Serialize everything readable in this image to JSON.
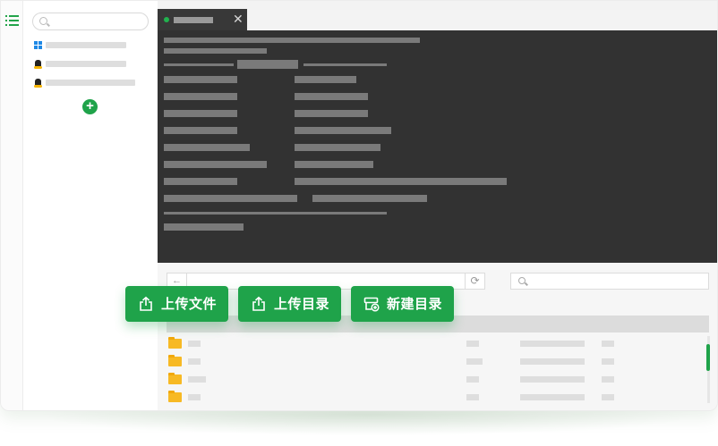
{
  "colors": {
    "accent": "#1fa34a",
    "terminal_bg": "#323232",
    "folder": "#f7b924"
  },
  "rail": {
    "menu_icon": "list-menu-icon"
  },
  "sidebar": {
    "search_placeholder": "",
    "hosts": [
      {
        "os_icon": "windows-icon"
      },
      {
        "os_icon": "linux-tux-icon"
      },
      {
        "os_icon": "linux-tux-icon"
      }
    ],
    "add_icon": "plus-circle-icon",
    "add_symbol": "+"
  },
  "terminal_tab": {
    "status": "connected",
    "close_symbol": "✕"
  },
  "file_browser": {
    "back_symbol": "←",
    "refresh_symbol": "⟳",
    "search_placeholder": "",
    "rows": [
      {
        "icon": "folder-icon"
      },
      {
        "icon": "folder-icon"
      },
      {
        "icon": "folder-icon"
      },
      {
        "icon": "folder-icon"
      }
    ]
  },
  "actions": {
    "upload_file": {
      "label": "上传文件",
      "icon": "upload-icon"
    },
    "upload_dir": {
      "label": "上传目录",
      "icon": "upload-icon"
    },
    "new_dir": {
      "label": "新建目录",
      "icon": "new-folder-icon"
    }
  }
}
